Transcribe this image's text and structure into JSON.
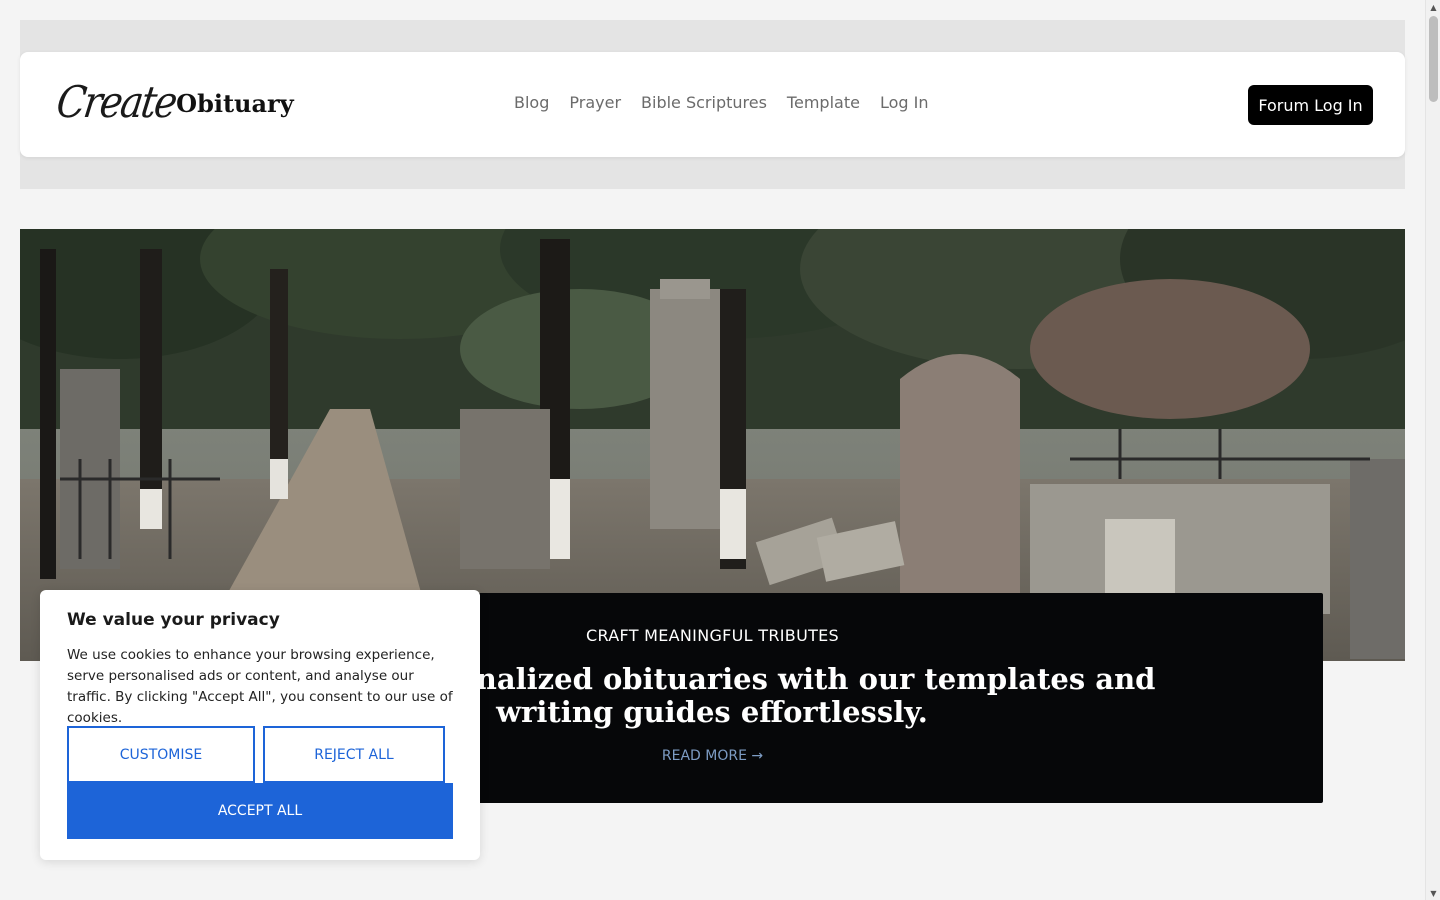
{
  "header": {
    "logo_script": "Create",
    "logo_bold": "Obituary",
    "nav": [
      "Blog",
      "Prayer",
      "Bible Scriptures",
      "Template",
      "Log In"
    ],
    "forum_button": "Forum Log In"
  },
  "hero": {
    "image_description": "cemetery path with trees and gravestones"
  },
  "tribute": {
    "kicker": "CRAFT MEANINGFUL TRIBUTES",
    "heading": "Create personalized obituaries with our templates and writing guides effortlessly.",
    "read_more": "READ MORE",
    "read_more_icon": "arrow-right-icon"
  },
  "cookie_banner": {
    "title": "We value your privacy",
    "text": "We use cookies to enhance your browsing experience, serve personalised ads or content, and analyse our traffic. By clicking \"Accept All\", you consent to our use of cookies.",
    "customise": "CUSTOMISE",
    "reject_all": "REJECT ALL",
    "accept_all": "ACCEPT ALL"
  },
  "colors": {
    "accent": "#1d64d8",
    "tribute_bg": "#060709",
    "header_button": "#000000"
  }
}
